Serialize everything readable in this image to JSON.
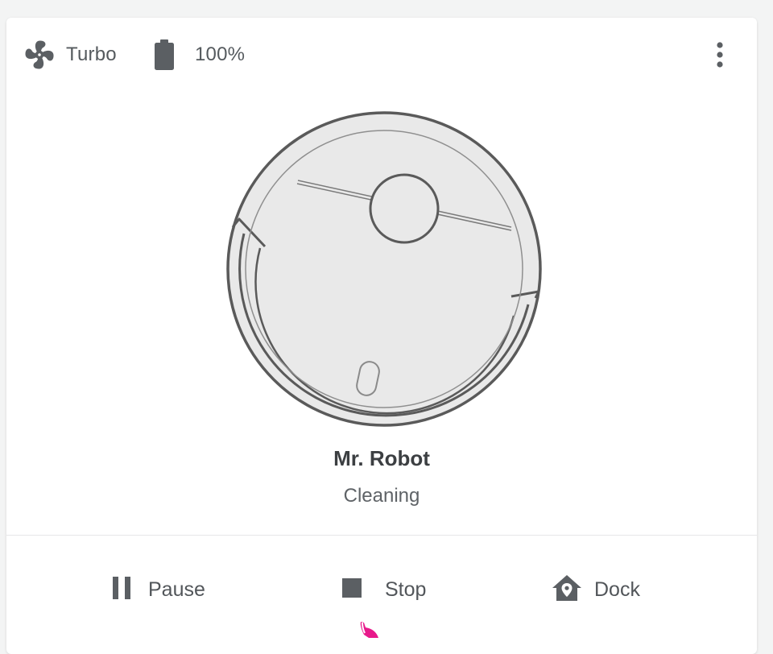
{
  "header": {
    "fan_mode": {
      "label": "Turbo",
      "icon": "fan-icon"
    },
    "battery": {
      "label": "100%",
      "level_percent": 100,
      "icon": "battery-icon"
    },
    "menu": {
      "icon": "more-vert-icon"
    }
  },
  "robot": {
    "name": "Mr. Robot",
    "status": "Cleaning",
    "image": "robot-vacuum-illustration"
  },
  "actions": [
    {
      "label": "Pause",
      "icon": "pause-icon"
    },
    {
      "label": "Stop",
      "icon": "stop-icon"
    },
    {
      "label": "Dock",
      "icon": "home-map-marker-icon"
    }
  ],
  "colors": {
    "icon": "#5b5f63",
    "text": "#52565a",
    "robot_body": "#e9e9e9",
    "robot_outline": "#5a5a5a",
    "cursor": "#e8198b"
  }
}
